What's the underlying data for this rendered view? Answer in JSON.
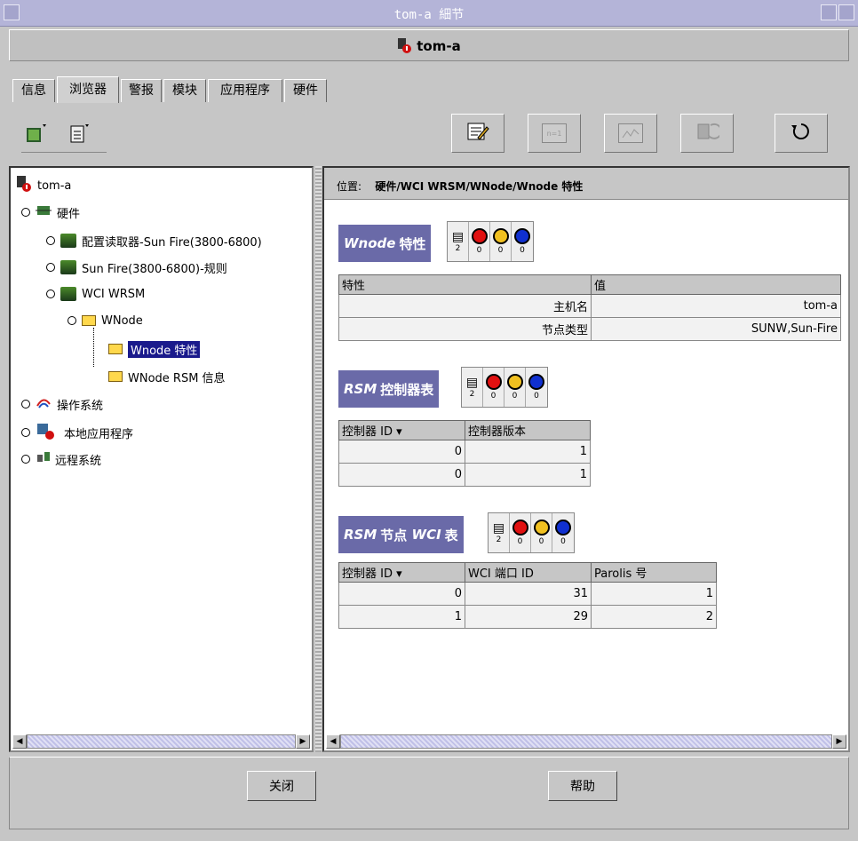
{
  "window": {
    "title": "tom-a 細节"
  },
  "host": {
    "name": "tom-a"
  },
  "tabs": [
    {
      "label": "信息"
    },
    {
      "label": "浏览器"
    },
    {
      "label": "警报"
    },
    {
      "label": "模块"
    },
    {
      "label": "应用程序"
    },
    {
      "label": "硬件"
    }
  ],
  "toolbar": {
    "right_icons": [
      "edit-icon",
      "n-1-icon",
      "graph-icon",
      "refresh-host-icon",
      "reload-icon"
    ],
    "left_icons": [
      "host-view-icon",
      "details-icon"
    ]
  },
  "tree": {
    "root": "tom-a",
    "hardware": "硬件",
    "config_reader": "配置读取器-Sun Fire(3800-6800)",
    "rules": "Sun Fire(3800-6800)-规则",
    "wci_wrsm": "WCI WRSM",
    "wnode": "WNode",
    "wnode_props": "Wnode 特性",
    "wnode_rsm": "WNode RSM 信息",
    "os": "操作系统",
    "local_apps": "本地应用程序",
    "remote": "远程系统"
  },
  "location": {
    "label": "位置:",
    "path": "硬件/WCI WRSM/WNode/Wnode 特性"
  },
  "status_counts": {
    "a": "2",
    "b": "0",
    "c": "0",
    "d": "0"
  },
  "section1": {
    "title_en": "Wnode",
    "title_cn": "特性",
    "headers": [
      "特性",
      "值"
    ],
    "rows": [
      [
        "主机名",
        "tom-a"
      ],
      [
        "节点类型",
        "SUNW,Sun-Fire"
      ]
    ]
  },
  "section2": {
    "title_en": "RSM",
    "title_cn": "控制器表",
    "headers": [
      "控制器 ID",
      "控制器版本"
    ],
    "rows": [
      [
        "0",
        "1"
      ],
      [
        "0",
        "1"
      ]
    ]
  },
  "section3": {
    "title_en1": "RSM",
    "title_cn1": "节点",
    "title_en2": "WCI",
    "title_cn2": "表",
    "headers": [
      "控制器 ID",
      "WCI 端口 ID",
      "Parolis 号"
    ],
    "rows": [
      [
        "0",
        "31",
        "1"
      ],
      [
        "1",
        "29",
        "2"
      ]
    ]
  },
  "buttons": {
    "close": "关闭",
    "help": "帮助"
  },
  "colors": {
    "title_bar": "#b4b4d8",
    "section_header": "#6a6aa8",
    "selection": "#1a1a8c"
  }
}
